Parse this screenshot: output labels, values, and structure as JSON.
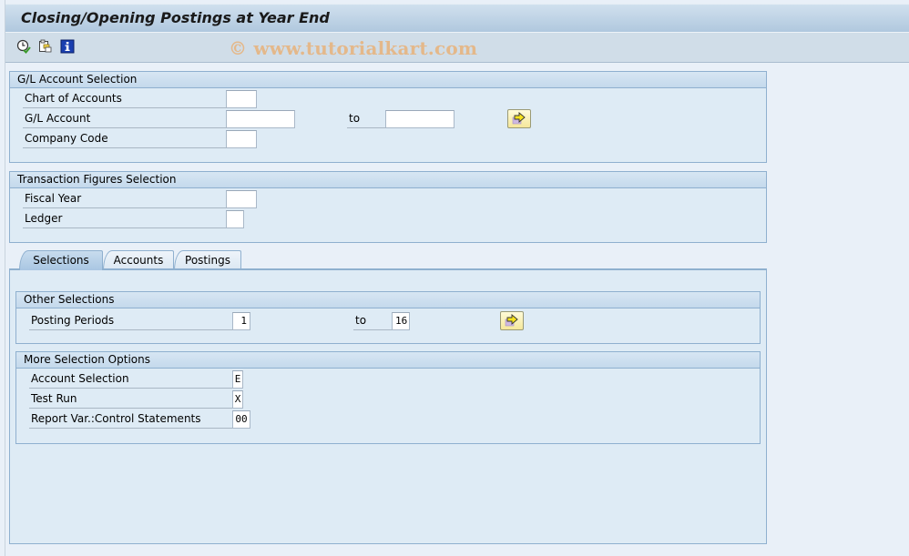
{
  "window": {
    "title": "Closing/Opening Postings at Year End"
  },
  "toolbar": {
    "icons": [
      {
        "name": "execute-icon",
        "tooltip": "Execute"
      },
      {
        "name": "get-variant-icon",
        "tooltip": "Get Variant"
      },
      {
        "name": "information-icon",
        "tooltip": "Program Documentation"
      }
    ],
    "watermark": "© www.tutorialkart.com"
  },
  "gl_account_selection": {
    "title": "G/L Account Selection",
    "fields": [
      {
        "label": "Chart of Accounts",
        "value": ""
      },
      {
        "label": "G/L Account",
        "value": "",
        "to_label": "to",
        "to_value": ""
      },
      {
        "label": "Company Code",
        "value": ""
      }
    ]
  },
  "transaction_figures_selection": {
    "title": "Transaction Figures Selection",
    "fields": [
      {
        "label": "Fiscal Year",
        "value": ""
      },
      {
        "label": "Ledger",
        "value": ""
      }
    ]
  },
  "tabs": [
    {
      "label": "Selections",
      "active": true
    },
    {
      "label": "Accounts",
      "active": false
    },
    {
      "label": "Postings",
      "active": false
    }
  ],
  "other_selections": {
    "title": "Other Selections",
    "posting_periods": {
      "label": "Posting Periods",
      "from": "1",
      "to_label": "to",
      "to": "16"
    }
  },
  "more_selection_options": {
    "title": "More Selection Options",
    "fields": [
      {
        "label": "Account Selection",
        "value": "E"
      },
      {
        "label": "Test Run",
        "value": "X"
      },
      {
        "label": "Report Var.:Control Statements",
        "value": "00"
      }
    ]
  },
  "colors": {
    "accent": "#8fb0cf",
    "background": "#e9f0f8",
    "multiple_selection_button": "#f5e79a"
  }
}
